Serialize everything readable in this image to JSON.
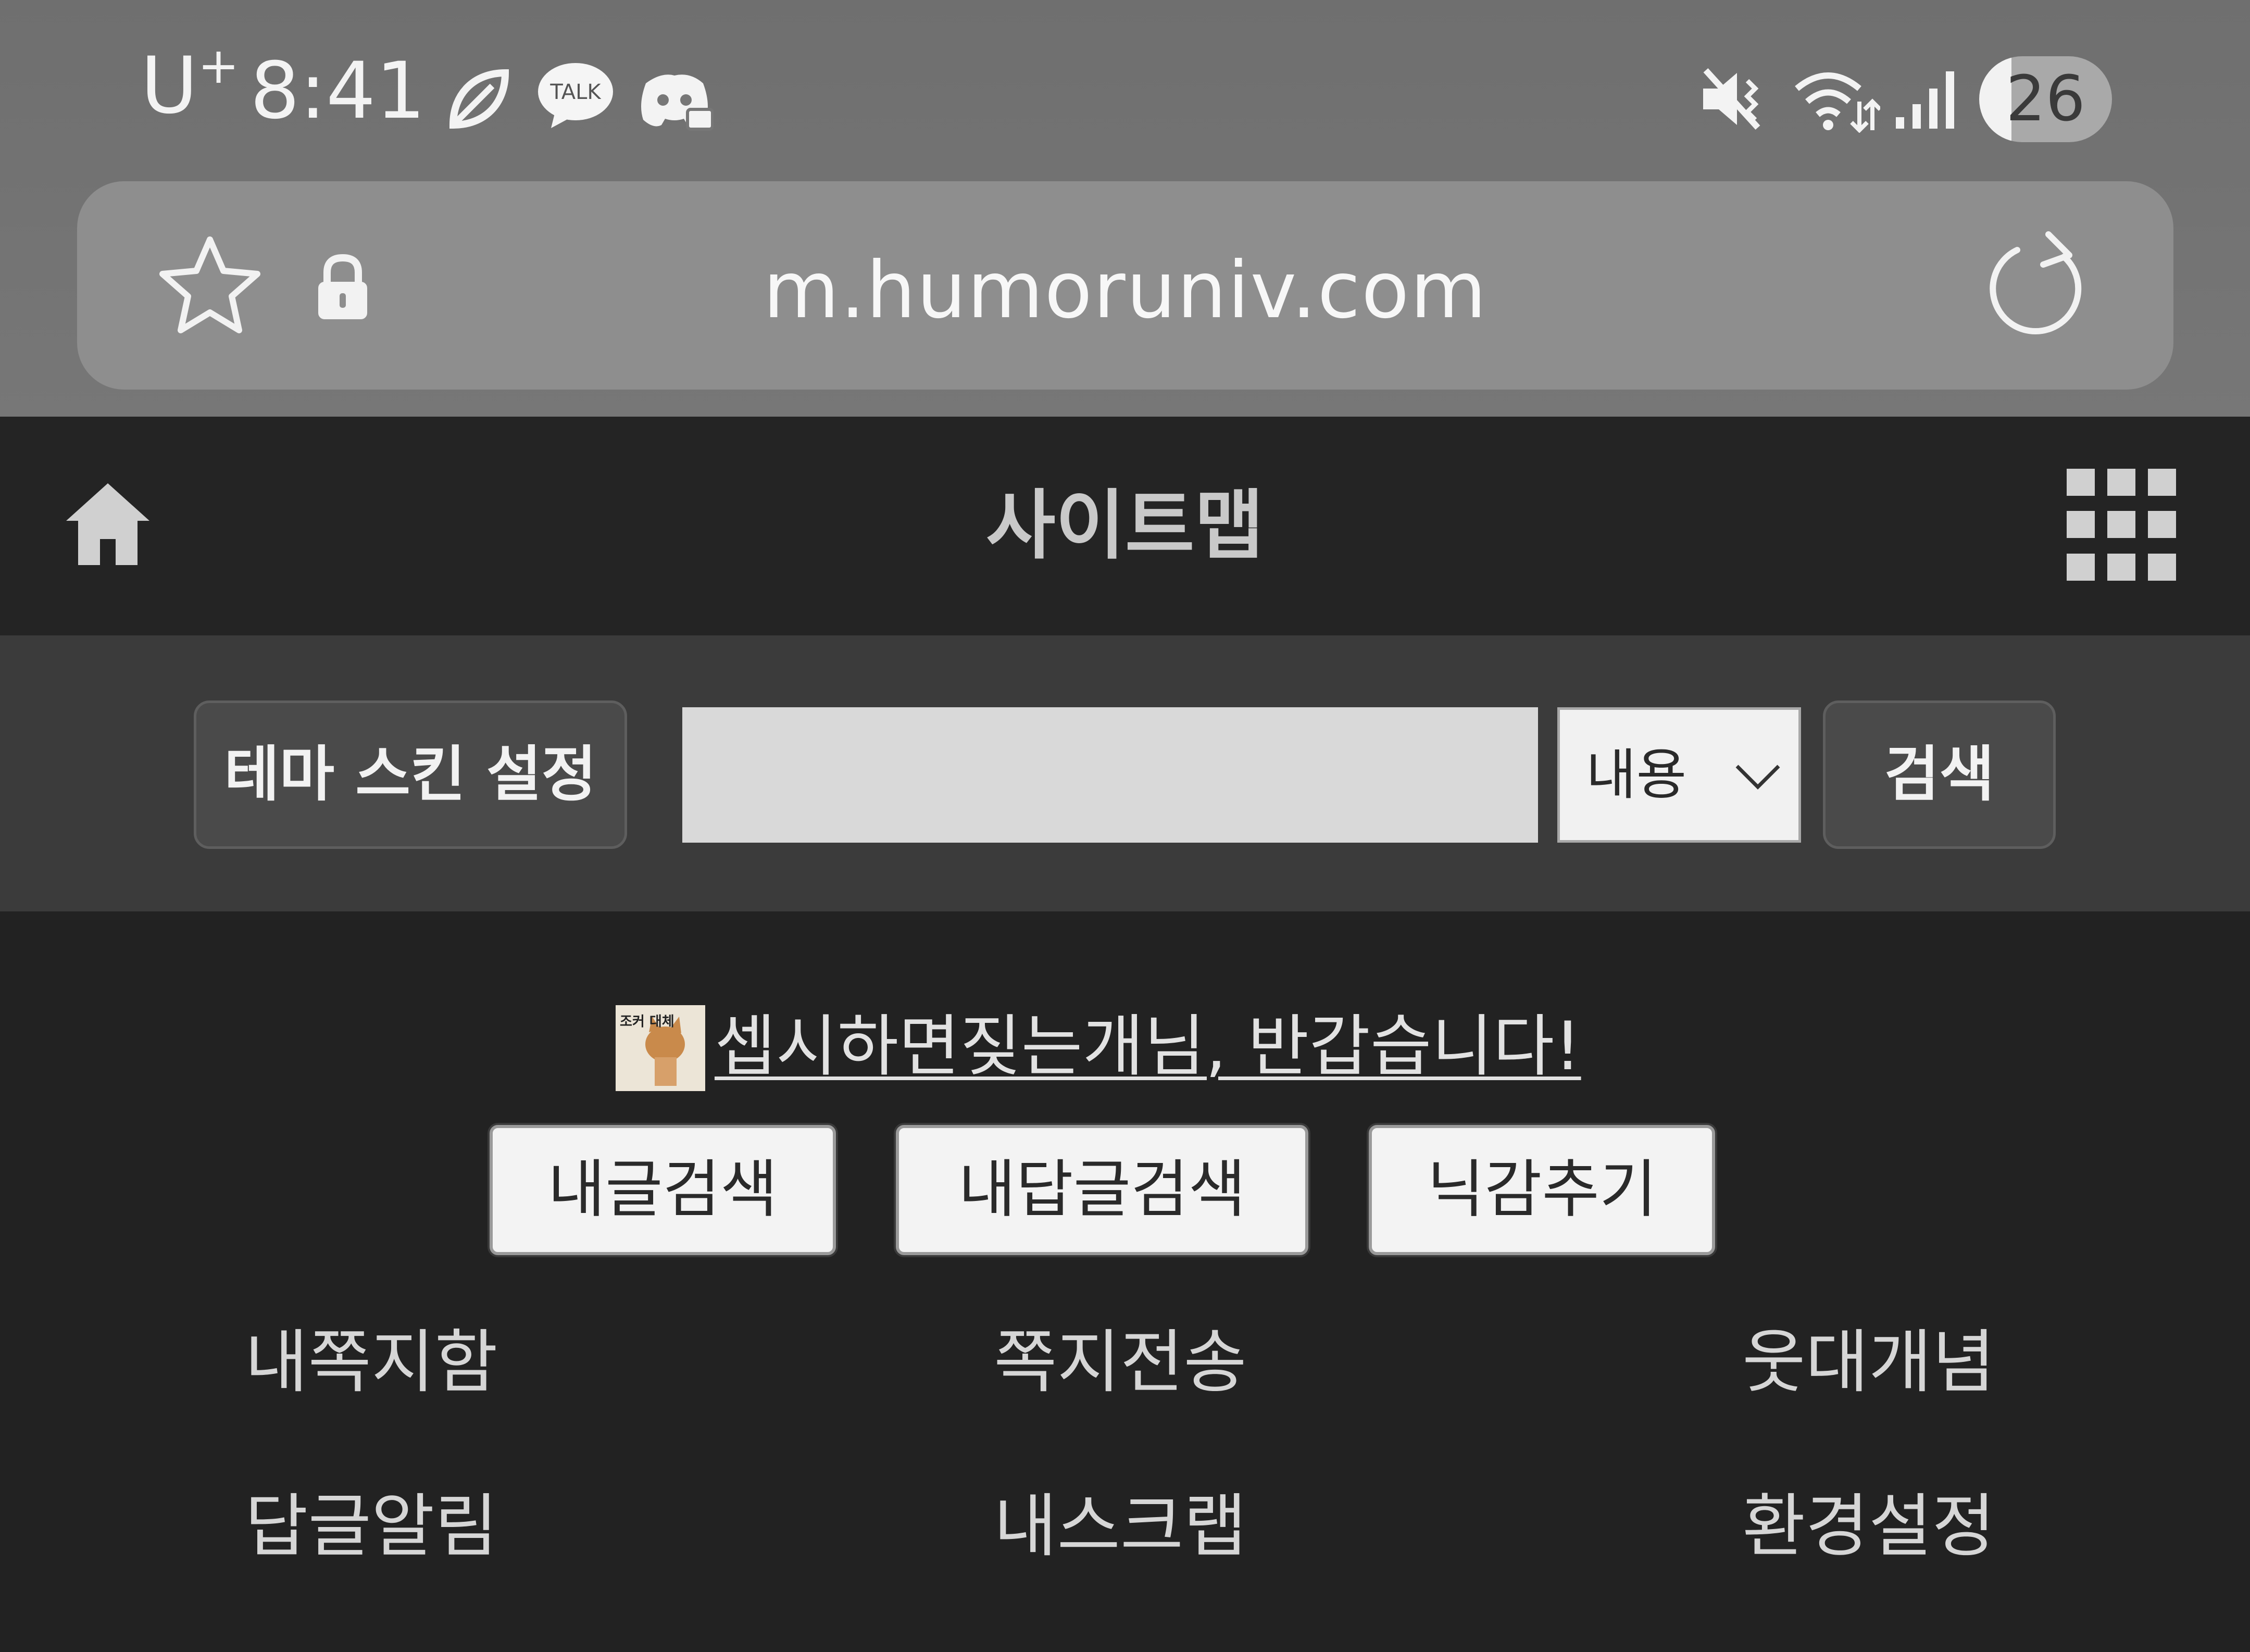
{
  "status_bar": {
    "carrier": "U",
    "carrier_sup": "+",
    "time": "8:41",
    "talk_label": "TALK",
    "battery": "26",
    "icons": [
      "leaf-icon",
      "kakaotalk-icon",
      "discord-icon",
      "mute-vibrate-icon",
      "wifi-icon",
      "signal-icon"
    ]
  },
  "browser": {
    "url": "m.humoruniv.com"
  },
  "site_header": {
    "title": "사이트맵"
  },
  "search": {
    "theme_button": "테마 스킨 설정",
    "input_value": "",
    "select_value": "내용",
    "search_button": "검색"
  },
  "main": {
    "welcome": "셉시하면짖는개님, 반갑습니다!",
    "avatar_text": "조커 대체",
    "buttons": {
      "my_posts": "내글검색",
      "my_replies": "내답글검색",
      "hide_nick": "닉감추기"
    },
    "links": {
      "inbox": "내쪽지함",
      "send_note": "쪽지전송",
      "concepts": "웃대개념",
      "reply_alerts": "답글알림",
      "scrap": "내스크랩",
      "settings": "환경설정"
    }
  },
  "colors": {
    "chrome": "#777777",
    "header": "#242424",
    "search_band": "#3b3b3b",
    "body": "#222222"
  }
}
